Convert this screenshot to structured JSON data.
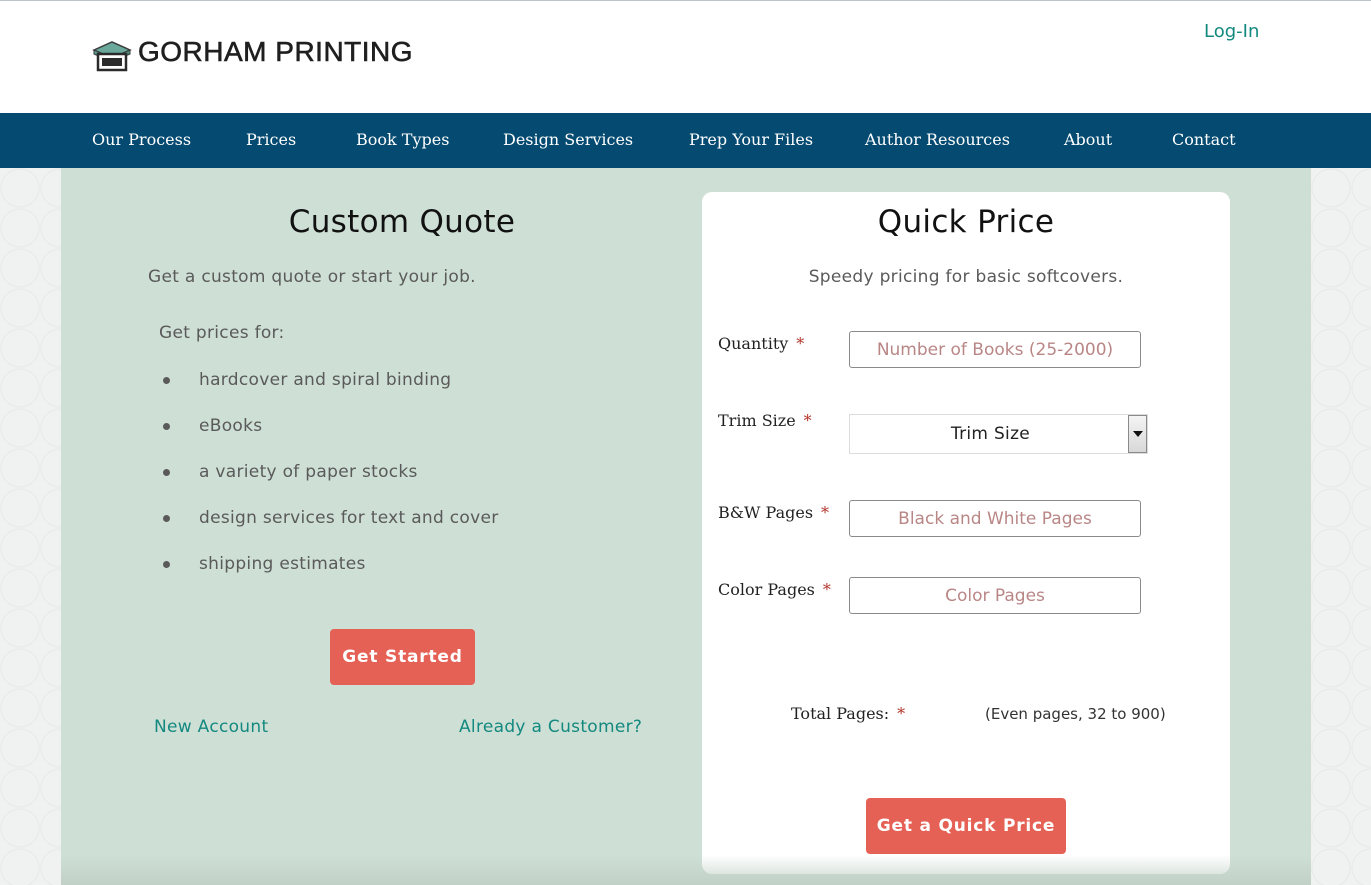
{
  "header": {
    "brand": "GORHAM PRINTING",
    "login": "Log-In"
  },
  "nav": {
    "items": [
      "Our Process",
      "Prices",
      "Book Types",
      "Design Services",
      "Prep Your Files",
      "Author Resources",
      "About",
      "Contact"
    ]
  },
  "custom_quote": {
    "title": "Custom Quote",
    "subtitle": "Get a custom quote or start your job.",
    "prices_intro": "Get prices for:",
    "items": [
      "hardcover and spiral binding",
      "eBooks",
      "a variety of paper stocks",
      "design services for text and cover",
      "shipping estimates"
    ],
    "button": "Get Started",
    "new_account": "New Account",
    "already_customer": "Already a Customer?"
  },
  "quick_price": {
    "title": "Quick Price",
    "subtitle": "Speedy pricing for basic softcovers.",
    "required_mark": "*",
    "quantity": {
      "label": "Quantity",
      "placeholder": "Number of Books (25-2000)"
    },
    "trim": {
      "label": "Trim Size",
      "value": "Trim Size"
    },
    "bw": {
      "label": "B&W Pages",
      "placeholder": "Black and White Pages"
    },
    "color": {
      "label": "Color Pages",
      "placeholder": "Color Pages"
    },
    "total": {
      "label": "Total Pages:",
      "hint": "(Even pages, 32 to 900)"
    },
    "button": "Get a Quick Price"
  },
  "colors": {
    "nav_bg": "#054a70",
    "main_bg": "#cedfd5",
    "accent_button": "#e56155",
    "link": "#13897f",
    "required": "#b2342a"
  },
  "icons": {
    "logo": "book-stack-icon",
    "select_arrow": "caret-down-icon"
  }
}
